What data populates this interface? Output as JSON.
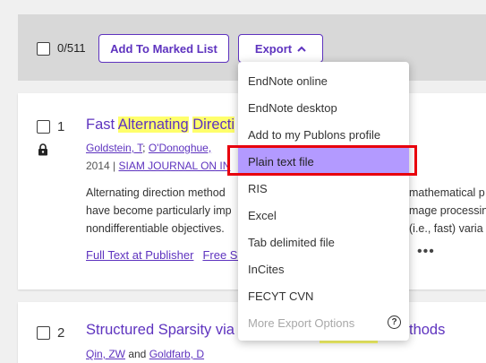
{
  "toolbar": {
    "selected_count": "0/511",
    "add_marked_label": "Add To Marked List",
    "export_label": "Export"
  },
  "export_menu": {
    "items": [
      {
        "label": "EndNote online",
        "state": "normal"
      },
      {
        "label": "EndNote desktop",
        "state": "normal"
      },
      {
        "label": "Add to my Publons profile",
        "state": "normal"
      },
      {
        "label": "Plain text file",
        "state": "highlighted"
      },
      {
        "label": "RIS",
        "state": "normal"
      },
      {
        "label": "Excel",
        "state": "normal"
      },
      {
        "label": "Tab delimited file",
        "state": "normal"
      },
      {
        "label": "InCites",
        "state": "normal"
      },
      {
        "label": "FECYT CVN",
        "state": "normal"
      },
      {
        "label": "More Export Options",
        "state": "disabled"
      }
    ],
    "help_icon": "?"
  },
  "records": [
    {
      "number": "1",
      "title_parts": [
        "Fast ",
        "Alternating",
        " ",
        "Directi"
      ],
      "author_1": "Goldstein, T",
      "author_sep": "; ",
      "author_2": "O'Donoghue, ",
      "year": "2014",
      "meta_sep": " | ",
      "journal": "SIAM JOURNAL ON IN",
      "abstract_lines": [
        "Alternating direction method",
        "have become particularly imp",
        "nondifferentiable objectives."
      ],
      "abstract_right": [
        "mathematical p",
        "mage processin",
        "(i.e., fast) varia"
      ],
      "full_text_label": "Full Text at Publisher",
      "free_label": "Free Su",
      "more_label": "•••"
    },
    {
      "number": "2",
      "title_left": "Structured Sparsity via",
      "title_right": "thods",
      "author_1": "Qin, ZW",
      "author_sep": " and ",
      "author_2": "Goldfarb, D"
    }
  ],
  "colors": {
    "accent": "#5e33bf",
    "highlight": "#ffff6b",
    "menu_active": "#b39aff",
    "callout": "#e8000d"
  }
}
